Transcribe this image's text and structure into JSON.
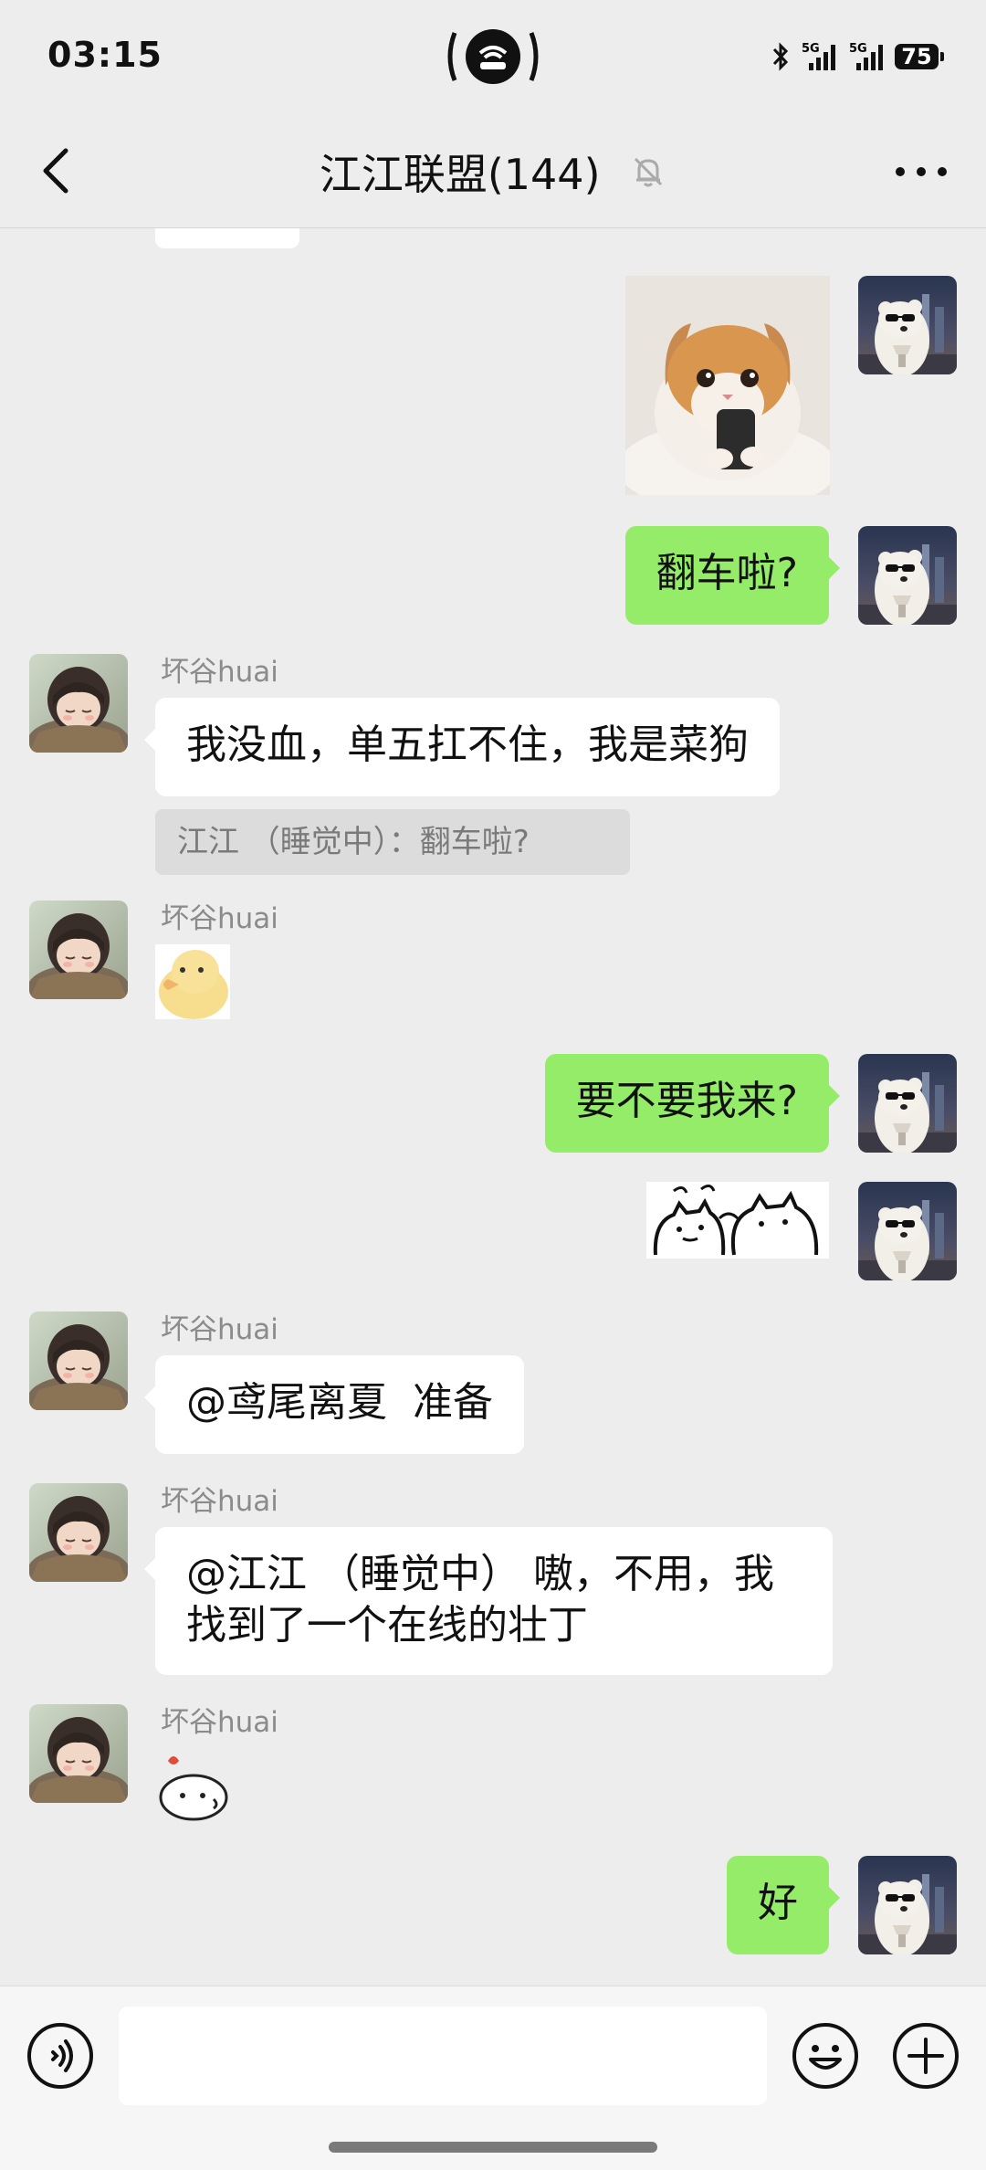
{
  "status_bar": {
    "time": "03:15",
    "network_1": "5G",
    "network_2": "5G",
    "battery": "75"
  },
  "header": {
    "title": "江江联盟(144)"
  },
  "messages": {
    "m2_text": "翻车啦?",
    "m3_sender": "坏谷huai",
    "m3_text": "我没血，单五扛不住，我是菜狗",
    "m3_quote": "江江 （睡觉中）：翻车啦?",
    "m4_sender": "坏谷huai",
    "m5_text": "要不要我来?",
    "m7_sender": "坏谷huai",
    "m7_text": "@鸢尾离夏  准备",
    "m8_sender": "坏谷huai",
    "m8_line1": "@江江 （睡觉中） 嗷，不用，我",
    "m8_line2": "找到了一个在线的壮丁",
    "m9_sender": "坏谷huai",
    "m10_text": "好"
  },
  "input": {
    "placeholder": ""
  },
  "colors": {
    "background": "#ededed",
    "own_bubble": "#95ec69",
    "other_bubble": "#ffffff"
  }
}
